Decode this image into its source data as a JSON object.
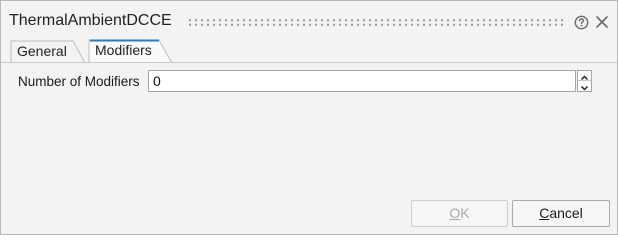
{
  "window": {
    "title": "ThermalAmbientDCCE",
    "help_icon": "help-circle-icon",
    "close_icon": "close-icon"
  },
  "tabs": [
    {
      "label": "General",
      "active": false
    },
    {
      "label": "Modifiers",
      "active": true
    }
  ],
  "modifiers_panel": {
    "number_label": "Number of Modifiers",
    "number_value": "0"
  },
  "buttons": {
    "ok": {
      "mnemonic": "O",
      "rest": "K",
      "enabled": false
    },
    "cancel": {
      "mnemonic": "C",
      "rest": "ancel",
      "enabled": true
    }
  },
  "colors": {
    "dialog_bg": "#f3f3f3",
    "active_tab_accent": "#2a7bbd",
    "border": "#b9b9b9",
    "disabled_text": "#a8a8a8"
  }
}
